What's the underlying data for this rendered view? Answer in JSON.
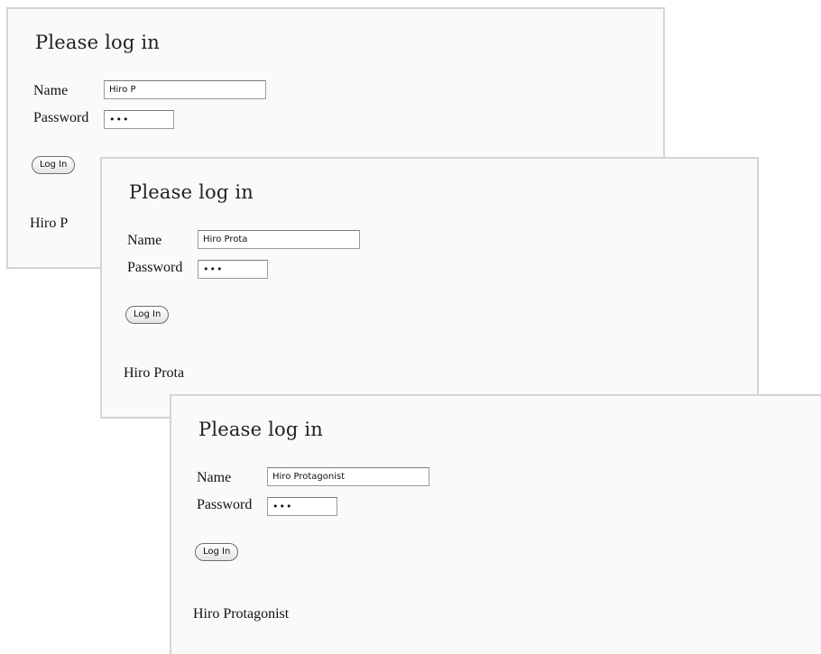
{
  "panels": [
    {
      "heading": "Please log in",
      "name_label": "Name",
      "name_value": "Hiro P",
      "password_label": "Password",
      "password_value": "•••",
      "button_label": "Log In",
      "result_text": "Hiro P"
    },
    {
      "heading": "Please log in",
      "name_label": "Name",
      "name_value": "Hiro Prota",
      "password_label": "Password",
      "password_value": "•••",
      "button_label": "Log In",
      "result_text": "Hiro Prota"
    },
    {
      "heading": "Please log in",
      "name_label": "Name",
      "name_value": "Hiro Protagonist",
      "password_label": "Password",
      "password_value": "•••",
      "button_label": "Log In",
      "result_text": "Hiro Protagonist"
    }
  ]
}
